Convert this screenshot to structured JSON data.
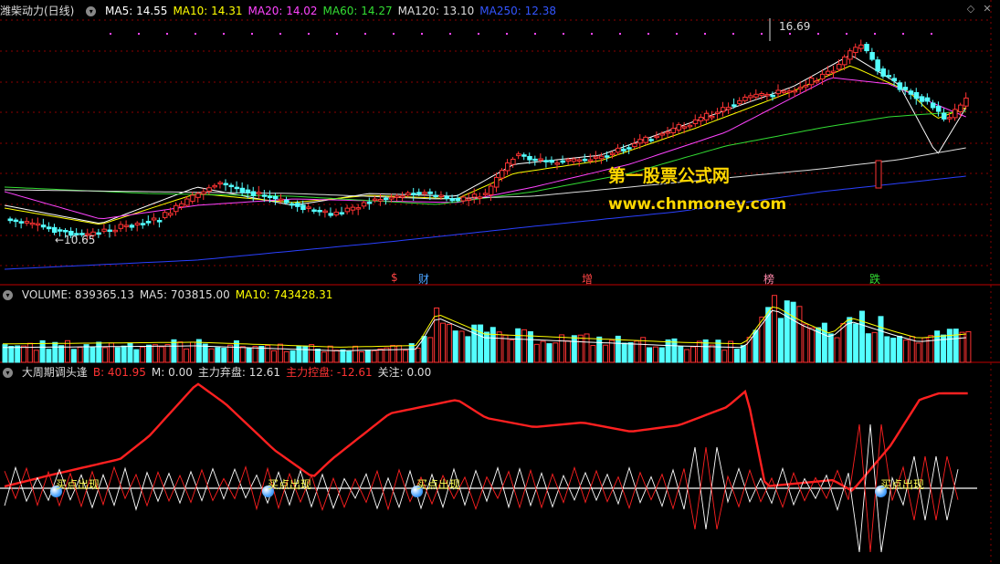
{
  "price_panel": {
    "title": "潍柴动力(日线)",
    "ma_labels": [
      {
        "text": "MA5: 14.55",
        "color": "#ffffff"
      },
      {
        "text": "MA10: 14.31",
        "color": "#ffff00"
      },
      {
        "text": "MA20: 14.02",
        "color": "#ff44ff"
      },
      {
        "text": "MA60: 14.27",
        "color": "#33dd33"
      },
      {
        "text": "MA120: 13.10",
        "color": "#dddddd"
      },
      {
        "text": "MA250: 12.38",
        "color": "#3355ff"
      }
    ],
    "high_label": "16.69",
    "low_label": "←10.65",
    "event_markers": [
      {
        "text": "$",
        "color": "#ff4444"
      },
      {
        "text": "财",
        "color": "#4aa3ff"
      },
      {
        "text": "增",
        "color": "#ff4444"
      },
      {
        "text": "榜",
        "color": "#ff88aa"
      },
      {
        "text": "跌",
        "color": "#33dd33"
      }
    ],
    "watermark_title": "第一股票公式网",
    "watermark_url": "www.chnmoney.com"
  },
  "volume_panel": {
    "labels": [
      {
        "text": "VOLUME: 839365.13",
        "color": "#dddddd"
      },
      {
        "text": "MA5: 703815.00",
        "color": "#dddddd"
      },
      {
        "text": "MA10: 743428.31",
        "color": "#ffff00"
      }
    ]
  },
  "indicator_panel": {
    "labels": [
      {
        "text": "大周期调头逢",
        "color": "#dddddd"
      },
      {
        "text": "B: 401.95",
        "color": "#ff3333"
      },
      {
        "text": "M: 0.00",
        "color": "#dddddd"
      },
      {
        "text": "主力弃盘: 12.61",
        "color": "#dddddd"
      },
      {
        "text": "主力控盘: -12.61",
        "color": "#ff3333"
      },
      {
        "text": "关注: 0.00",
        "color": "#dddddd"
      }
    ],
    "buy_signal_label": "买点出现"
  },
  "colors": {
    "up": "#ff3333",
    "down": "#54ffff",
    "grid": "#8b0000",
    "divider": "#c00000"
  },
  "icons": {
    "collapse": "chevron-down-icon",
    "restore": "diamond-icon",
    "close": "close-icon"
  }
}
